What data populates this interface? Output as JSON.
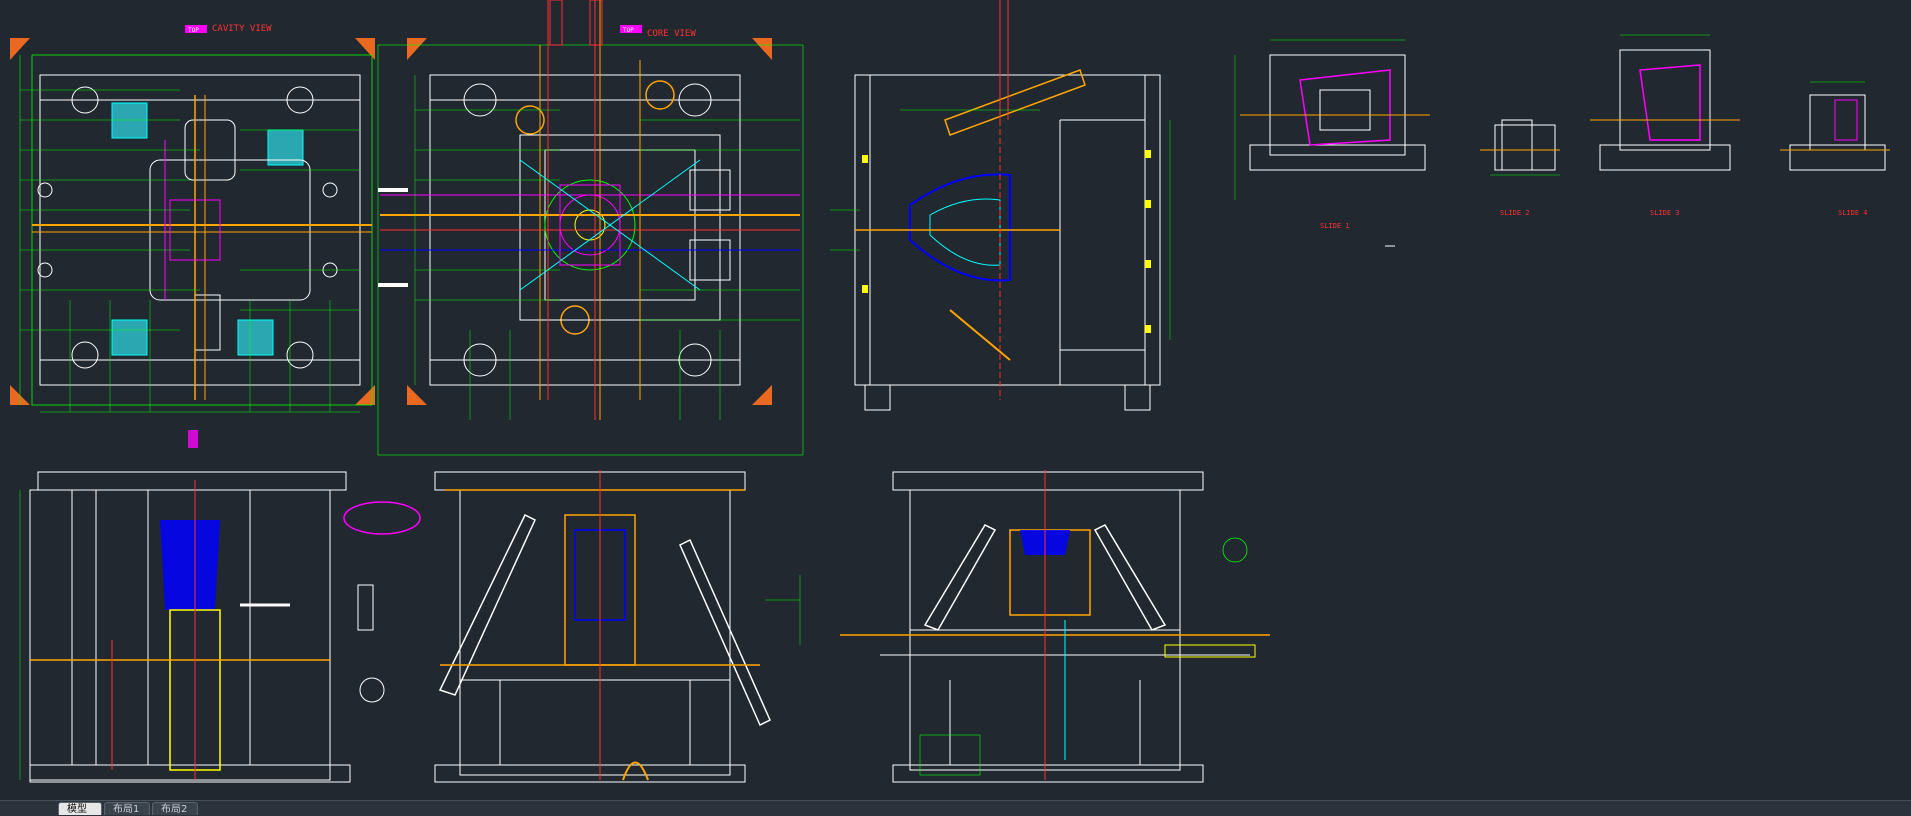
{
  "drawing": {
    "title_cavity": "CAVITY VIEW",
    "title_core": "CORE VIEW",
    "tag_top": "TOP",
    "slides": [
      "SLIDE 1",
      "SLIDE 2",
      "SLIDE 3",
      "SLIDE 4"
    ],
    "colors": {
      "background": "#212830",
      "white": "#ffffff",
      "green": "#00ff00",
      "yellow": "#ffff00",
      "red": "#ff3030",
      "magenta": "#ff00ff",
      "blue": "#0000ff",
      "orange": "#ffa500",
      "cyan": "#00ffff"
    }
  },
  "tabs": {
    "model": "模型",
    "layout1": "布局1",
    "layout2": "布局2"
  }
}
